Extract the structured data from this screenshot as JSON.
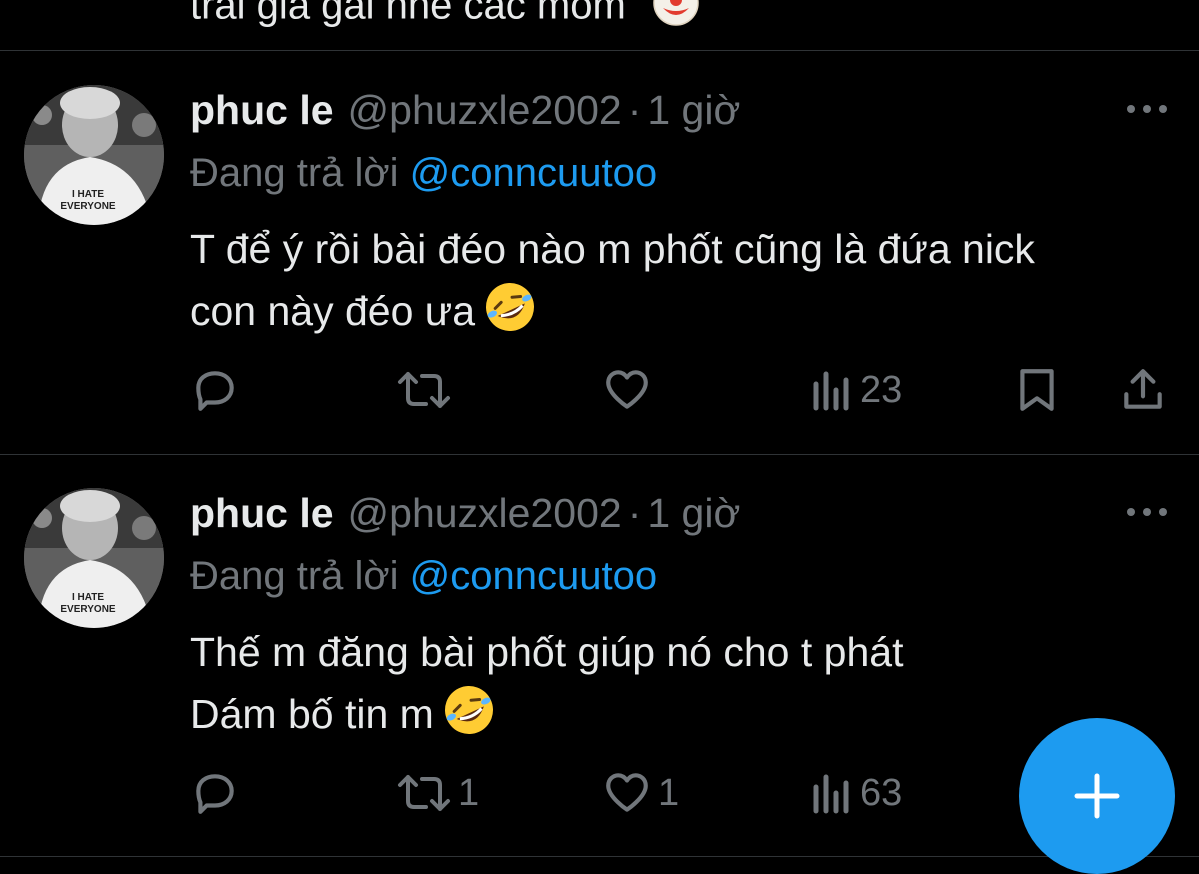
{
  "previous_tweet": {
    "text_fragment": "trai gia gai nhe cac mom"
  },
  "tweets": [
    {
      "name": "phuc le",
      "handle": "@phuzxle2002",
      "separator": "·",
      "time": "1 giờ",
      "replying_to_label": "Đang trả lời",
      "replying_to_handle": "@conncuutoo",
      "body_lines": [
        "T để ý rồi bài đéo nào m phốt cũng là đứa nick",
        "con này đéo ưa"
      ],
      "avatar_shirt_text": [
        "I HATE",
        "EVERYONE"
      ],
      "stats": {
        "reply": "",
        "retweet": "",
        "like": "",
        "views": "23"
      }
    },
    {
      "name": "phuc le",
      "handle": "@phuzxle2002",
      "separator": "·",
      "time": "1 giờ",
      "replying_to_label": "Đang trả lời",
      "replying_to_handle": "@conncuutoo",
      "body_lines": [
        "Thế m đăng bài phốt giúp nó cho t phát",
        "Dám bố tin m"
      ],
      "avatar_shirt_text": [
        "I HATE",
        "EVERYONE"
      ],
      "stats": {
        "reply": "",
        "retweet": "1",
        "like": "1",
        "views": "63"
      }
    }
  ],
  "colors": {
    "background": "#000000",
    "text_primary": "#e7e9ea",
    "text_secondary": "#71767b",
    "accent": "#1d9bf0",
    "divider": "#2f3336"
  },
  "icons": {
    "reply": "reply-icon",
    "retweet": "retweet-icon",
    "like": "heart-icon",
    "views": "views-icon",
    "bookmark": "bookmark-icon",
    "share": "share-icon",
    "more": "more-icon",
    "compose": "plus-icon",
    "emoji_laugh": "rofl-emoji-icon",
    "emoji_clown": "clown-emoji-icon"
  }
}
